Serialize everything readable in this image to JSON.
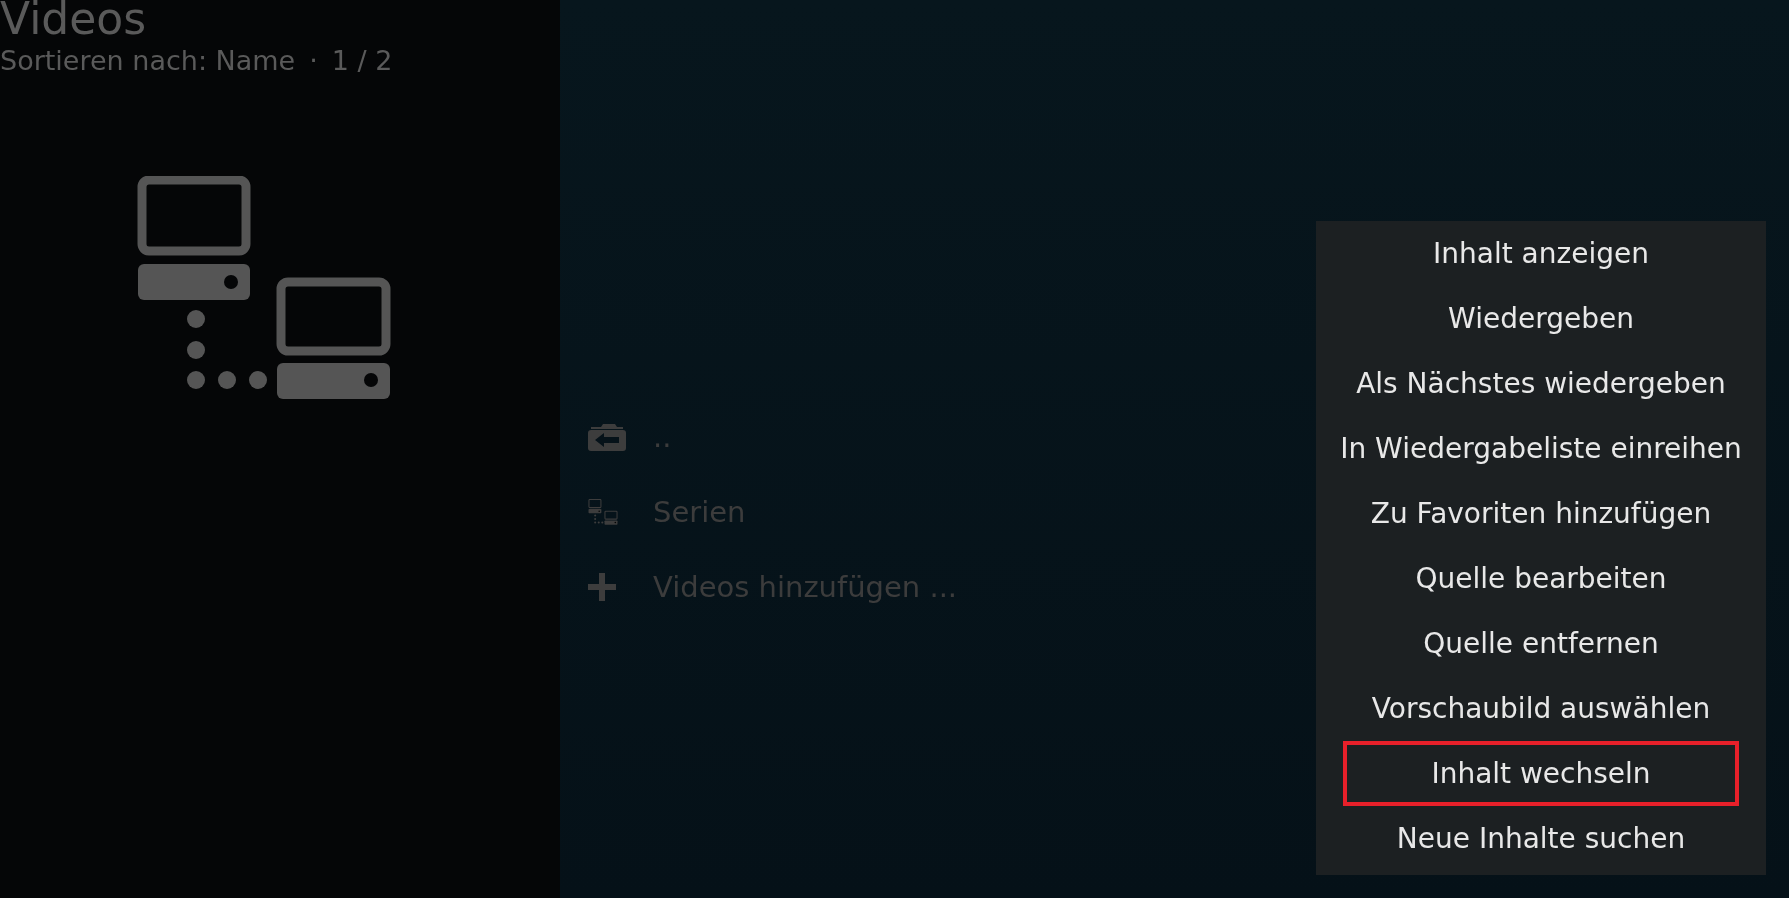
{
  "header": {
    "title": "Videos",
    "sort_label": "Sortieren nach: Name",
    "separator": "·",
    "page": "1 / 2"
  },
  "list": [
    {
      "kind": "parent-folder",
      "label": ".."
    },
    {
      "kind": "network",
      "label": "Serien"
    },
    {
      "kind": "add",
      "label": "Videos hinzufügen ..."
    }
  ],
  "context_menu": [
    {
      "label": "Inhalt anzeigen",
      "selected": false
    },
    {
      "label": "Wiedergeben",
      "selected": false
    },
    {
      "label": "Als Nächstes wiedergeben",
      "selected": false
    },
    {
      "label": "In Wiedergabeliste einreihen",
      "selected": false
    },
    {
      "label": "Zu Favoriten hinzufügen",
      "selected": false
    },
    {
      "label": "Quelle bearbeiten",
      "selected": false
    },
    {
      "label": "Quelle entfernen",
      "selected": false
    },
    {
      "label": "Vorschaubild auswählen",
      "selected": false
    },
    {
      "label": "Inhalt wechseln",
      "selected": true
    },
    {
      "label": "Neue Inhalte suchen",
      "selected": false
    }
  ]
}
